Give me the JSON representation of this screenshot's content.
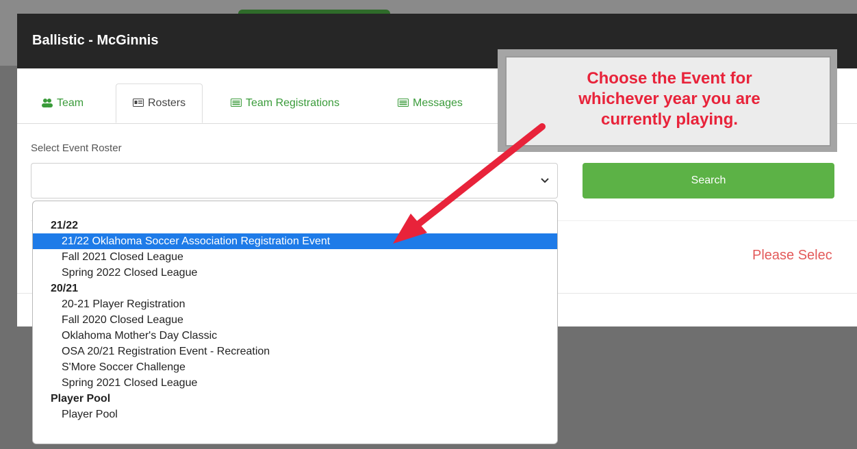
{
  "modal": {
    "title": "Ballistic - McGinnis",
    "tabs": [
      {
        "label": "Team",
        "icon": "users-icon"
      },
      {
        "label": "Rosters",
        "icon": "id-card-icon"
      },
      {
        "label": "Team Registrations",
        "icon": "list-icon"
      },
      {
        "label": "Messages",
        "icon": "list-icon"
      }
    ],
    "select_label": "Select Event Roster",
    "select_value": "",
    "search_label": "Search",
    "please_select": "Please Selec"
  },
  "dropdown": {
    "items": [
      {
        "type": "group",
        "label": "21/22"
      },
      {
        "type": "option",
        "label": "21/22 Oklahoma Soccer Association Registration Event",
        "selected": true
      },
      {
        "type": "option",
        "label": "Fall 2021 Closed League"
      },
      {
        "type": "option",
        "label": "Spring 2022 Closed League"
      },
      {
        "type": "group",
        "label": "20/21"
      },
      {
        "type": "option",
        "label": "20-21 Player Registration"
      },
      {
        "type": "option",
        "label": "Fall 2020 Closed League"
      },
      {
        "type": "option",
        "label": "Oklahoma Mother's Day Classic"
      },
      {
        "type": "option",
        "label": "OSA 20/21 Registration Event - Recreation"
      },
      {
        "type": "option",
        "label": "S'More Soccer Challenge"
      },
      {
        "type": "option",
        "label": "Spring 2021 Closed League"
      },
      {
        "type": "group",
        "label": "Player Pool"
      },
      {
        "type": "option",
        "label": "Player Pool"
      }
    ]
  },
  "callout": {
    "line1": "Choose the Event for",
    "line2": "whichever year you are",
    "line3": "currently playing."
  },
  "colors": {
    "accent_green": "#5cb246",
    "tab_green": "#3a9b3a",
    "header_dark": "#262626",
    "selection_blue": "#1e7be8",
    "callout_red": "#e8233a"
  }
}
